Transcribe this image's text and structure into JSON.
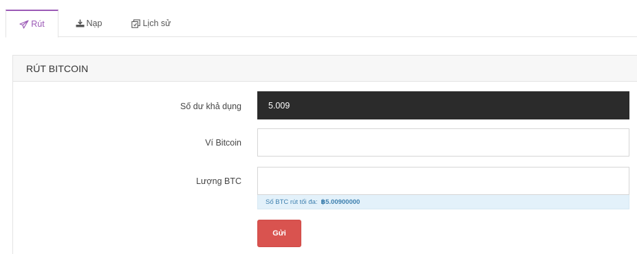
{
  "tabs": [
    {
      "label": "Rút",
      "icon": "send-icon",
      "active": true
    },
    {
      "label": "Nạp",
      "icon": "download-icon",
      "active": false
    },
    {
      "label": "Lịch sử",
      "icon": "history-icon",
      "active": false
    }
  ],
  "panel": {
    "title": "RÚT BITCOIN"
  },
  "form": {
    "balance_label": "Số dư khả dụng",
    "balance_value": "5.009",
    "wallet_label": "Ví Bitcoin",
    "wallet_value": "",
    "wallet_placeholder": "",
    "amount_label": "Lượng BTC",
    "amount_value": "",
    "amount_placeholder": "",
    "max_hint_label": "Số BTC rút tối đa:",
    "max_hint_value": "฿5.00900000",
    "submit_label": "Gửi"
  },
  "colors": {
    "active_tab": "#9b59b6",
    "balance_bg": "#2b2b2b",
    "hint_bg": "#e3f1fa",
    "hint_text": "#3d7fae",
    "submit_bg": "#d9534f"
  }
}
